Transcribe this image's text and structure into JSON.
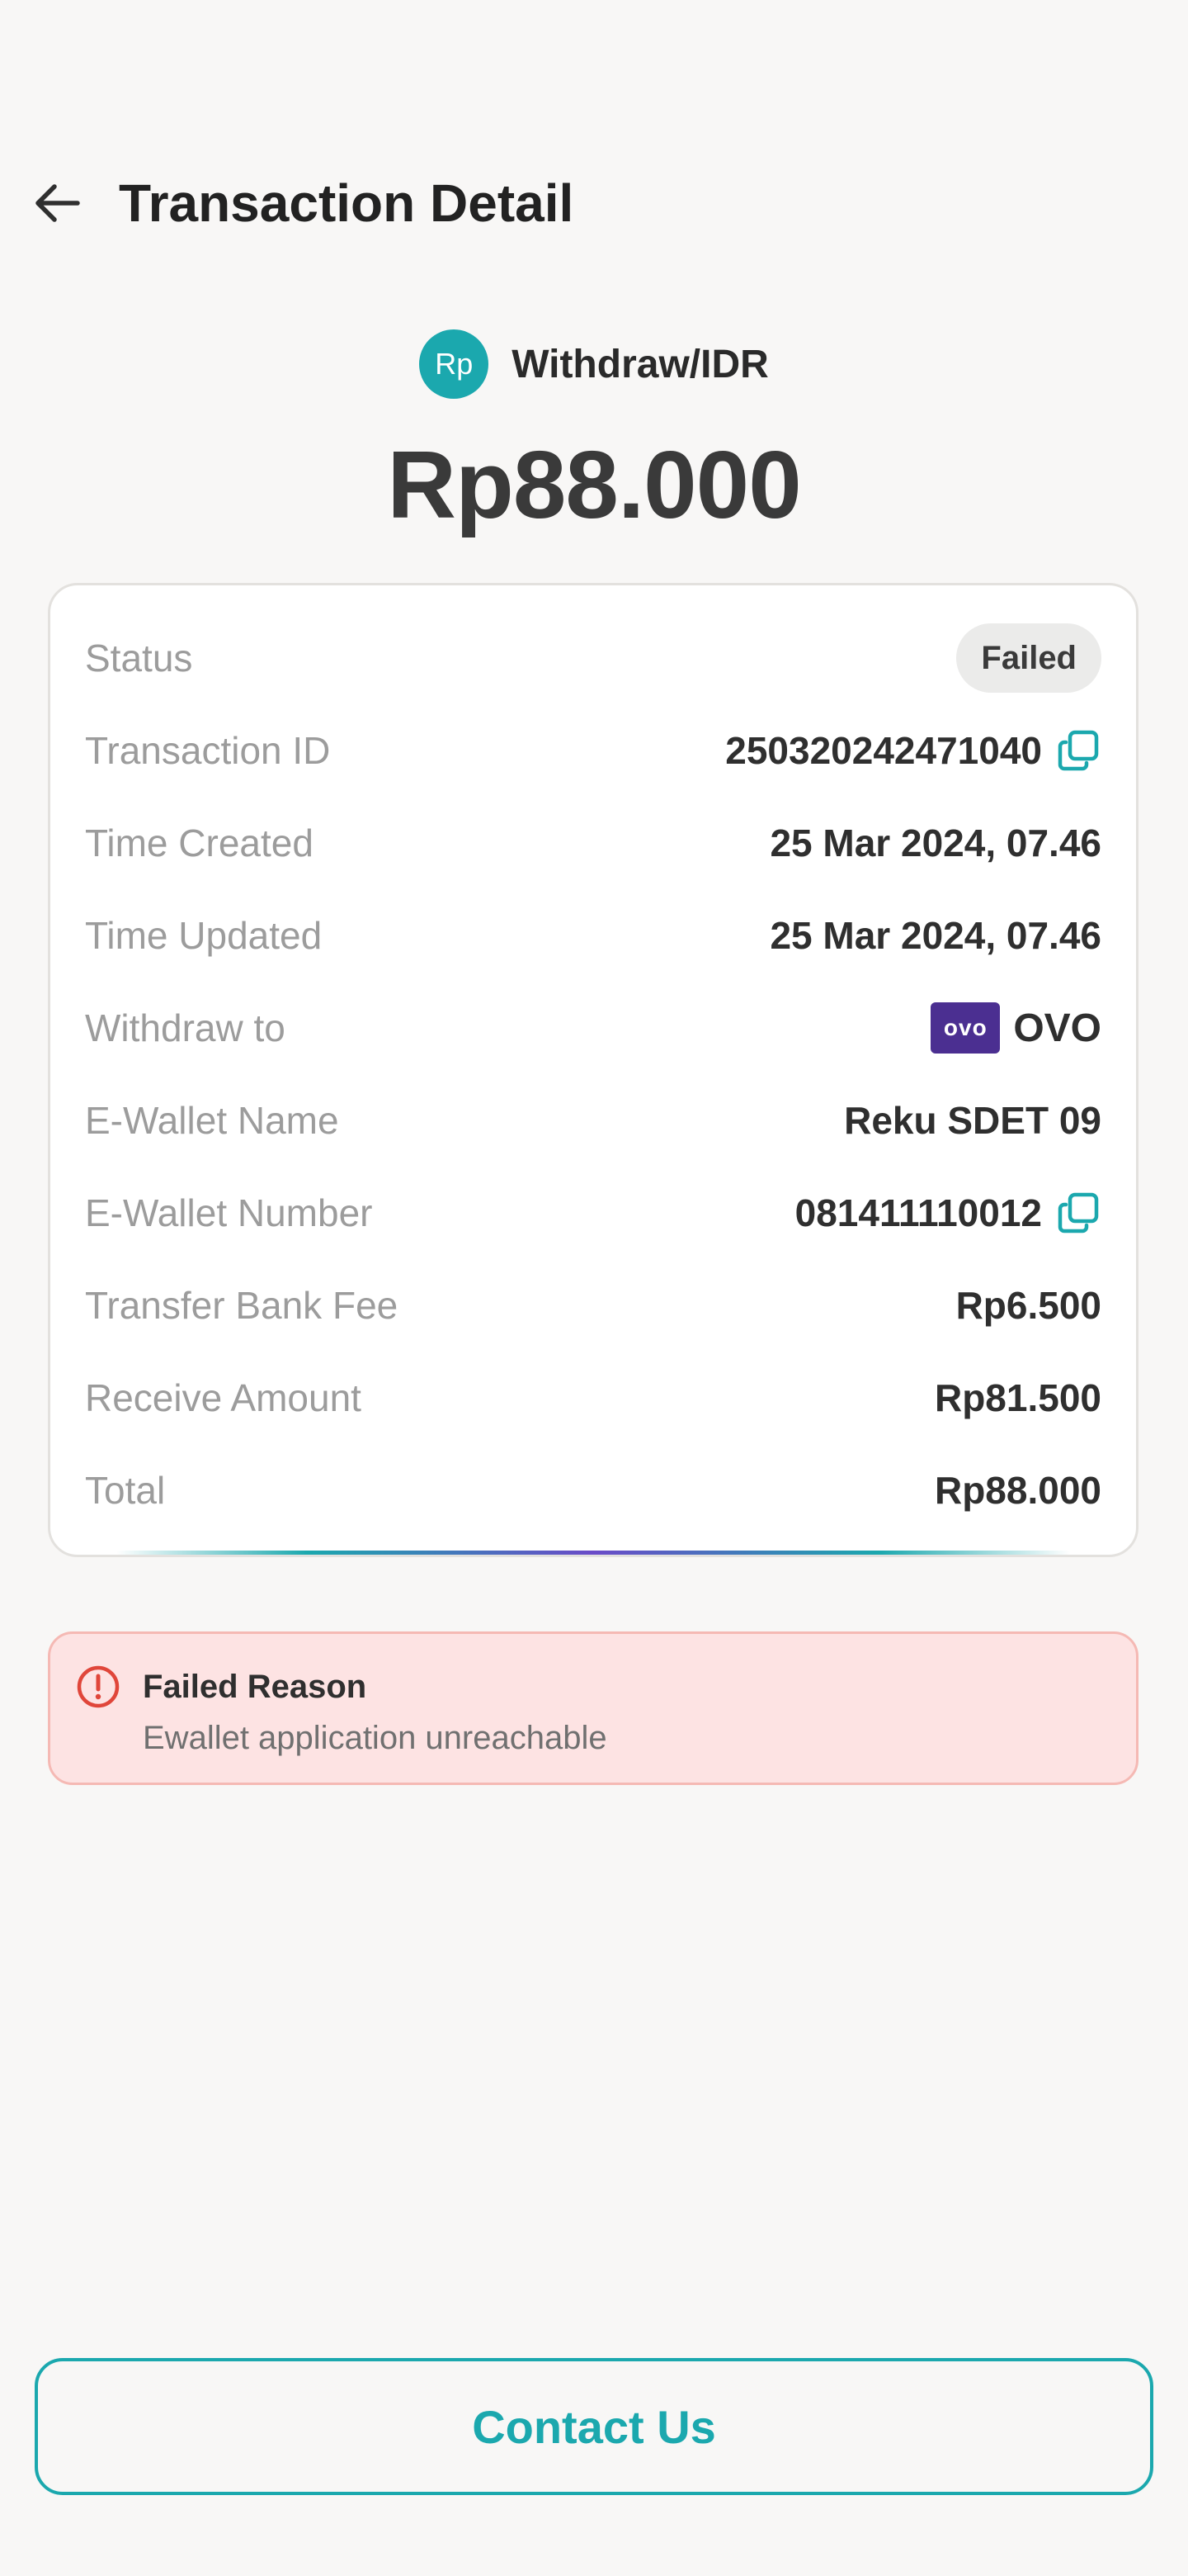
{
  "header": {
    "title": "Transaction Detail"
  },
  "transaction": {
    "currency_badge": "Rp",
    "type_label": "Withdraw/IDR",
    "amount": "Rp88.000"
  },
  "details": [
    {
      "key": "status",
      "label": "Status",
      "value": "Failed"
    },
    {
      "key": "transaction_id",
      "label": "Transaction ID",
      "value": "250320242471040"
    },
    {
      "key": "time_created",
      "label": "Time Created",
      "value": "25 Mar 2024, 07.46"
    },
    {
      "key": "time_updated",
      "label": "Time Updated",
      "value": "25 Mar 2024, 07.46"
    },
    {
      "key": "withdraw_to",
      "label": "Withdraw to",
      "logo_text": "ovo",
      "value": "OVO"
    },
    {
      "key": "ewallet_name",
      "label": "E-Wallet Name",
      "value": "Reku SDET 09"
    },
    {
      "key": "ewallet_number",
      "label": "E-Wallet Number",
      "value": "081411110012"
    },
    {
      "key": "transfer_fee",
      "label": "Transfer Bank Fee",
      "value": "Rp6.500"
    },
    {
      "key": "receive_amount",
      "label": "Receive Amount",
      "value": "Rp81.500"
    },
    {
      "key": "total",
      "label": "Total",
      "value": "Rp88.000"
    }
  ],
  "failed_reason": {
    "title": "Failed Reason",
    "text": "Ewallet application unreachable",
    "icon": "alert-circle-icon"
  },
  "actions": {
    "contact_label": "Contact Us"
  },
  "colors": {
    "accent": "#1ba8ae",
    "error_bg": "#fde3e3",
    "error_border": "#f5b9b4",
    "error_icon": "#e0463a",
    "ovo_brand": "#4b2f91"
  }
}
